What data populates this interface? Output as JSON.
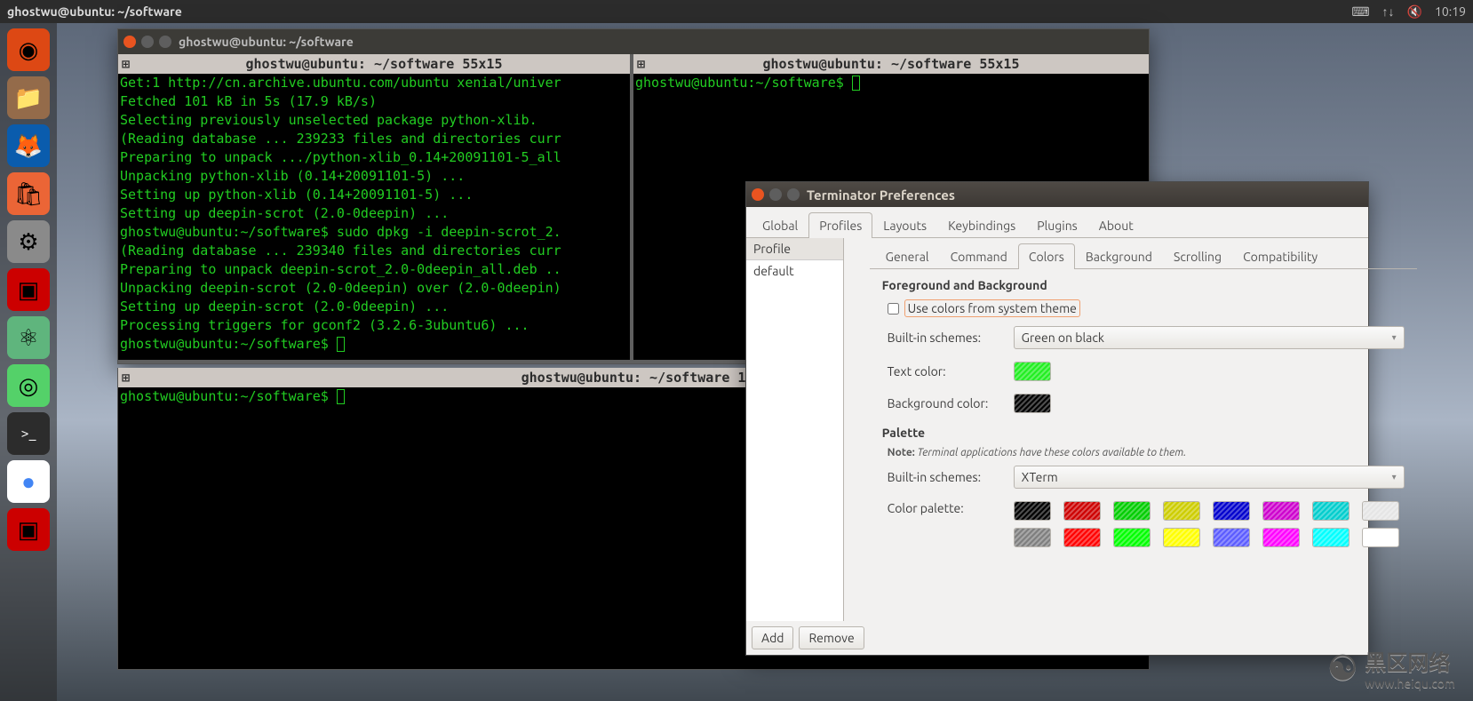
{
  "menubar": {
    "title": "ghostwu@ubuntu: ~/software",
    "time": "10:19"
  },
  "launcher": {
    "items": [
      {
        "name": "dash",
        "color": "#dd4814",
        "glyph": "◉"
      },
      {
        "name": "files",
        "color": "#946b4a",
        "glyph": "📁"
      },
      {
        "name": "firefox",
        "color": "#0a5cad",
        "glyph": "🦊"
      },
      {
        "name": "software",
        "color": "#eb6536",
        "glyph": "🛍"
      },
      {
        "name": "settings",
        "color": "#8a8a8a",
        "glyph": "⚙"
      },
      {
        "name": "terminator1",
        "color": "#c00",
        "glyph": "▣"
      },
      {
        "name": "atom",
        "color": "#5fb57d",
        "glyph": "⚛"
      },
      {
        "name": "app-green",
        "color": "#54d169",
        "glyph": "◎"
      },
      {
        "name": "terminal",
        "color": "#2c2c2c",
        "glyph": ">_"
      },
      {
        "name": "chrome",
        "color": "#fff",
        "glyph": "◯"
      },
      {
        "name": "terminator2",
        "color": "#c00",
        "glyph": "▣"
      }
    ]
  },
  "terminal_window": {
    "title": "ghostwu@ubuntu: ~/software",
    "panes": {
      "top_left": {
        "tab": "ghostwu@ubuntu: ~/software 55x15",
        "lines": [
          "Get:1 http://cn.archive.ubuntu.com/ubuntu xenial/univer",
          "Fetched 101 kB in 5s (17.9 kB/s)",
          "Selecting previously unselected package python-xlib.",
          "(Reading database ... 239233 files and directories curr",
          "Preparing to unpack .../python-xlib_0.14+20091101-5_all",
          "Unpacking python-xlib (0.14+20091101-5) ...",
          "Setting up python-xlib (0.14+20091101-5) ...",
          "Setting up deepin-scrot (2.0-0deepin) ...",
          "ghostwu@ubuntu:~/software$ sudo dpkg -i deepin-scrot_2.",
          "(Reading database ... 239340 files and directories curr",
          "Preparing to unpack deepin-scrot_2.0-0deepin_all.deb ..",
          "Unpacking deepin-scrot (2.0-0deepin) over (2.0-0deepin)",
          "Setting up deepin-scrot (2.0-0deepin) ...",
          "Processing triggers for gconf2 (3.2.6-3ubuntu6) ...",
          "ghostwu@ubuntu:~/software$ "
        ]
      },
      "top_right": {
        "tab": "ghostwu@ubuntu: ~/software 55x15",
        "prompt": "ghostwu@ubuntu:~/software$ "
      },
      "bottom": {
        "tab": "ghostwu@ubuntu: ~/software 1",
        "prompt": "ghostwu@ubuntu:~/software$ "
      }
    }
  },
  "prefs": {
    "title": "Terminator Preferences",
    "main_tabs": [
      "Global",
      "Profiles",
      "Layouts",
      "Keybindings",
      "Plugins",
      "About"
    ],
    "main_active": "Profiles",
    "profile_header": "Profile",
    "profile_item": "default",
    "sub_tabs": [
      "General",
      "Command",
      "Colors",
      "Background",
      "Scrolling",
      "Compatibility"
    ],
    "sub_active": "Colors",
    "fg_bg_heading": "Foreground and Background",
    "use_system_label": "Use colors from system theme",
    "builtin_label": "Built-in schemes:",
    "builtin_value": "Green on black",
    "text_color_label": "Text color:",
    "text_color": "#22ee22",
    "bg_color_label": "Background color:",
    "bg_color": "#000000",
    "palette_heading": "Palette",
    "note_label": "Note:",
    "note_text": "Terminal applications have these colors available to them.",
    "palette_scheme_label": "Built-in schemes:",
    "palette_scheme_value": "XTerm",
    "color_palette_label": "Color palette:",
    "palette_colors": [
      "#000000",
      "#cd0000",
      "#00cd00",
      "#cdcd00",
      "#0000cd",
      "#cd00cd",
      "#00cdcd",
      "#e5e5e5",
      "#7f7f7f",
      "#ff0000",
      "#00ff00",
      "#ffff00",
      "#5c5cff",
      "#ff00ff",
      "#00ffff",
      "#ffffff"
    ],
    "add_btn": "Add",
    "remove_btn": "Remove"
  },
  "watermark": {
    "brand": "黑区网络",
    "url": "www.heiqu.com"
  }
}
